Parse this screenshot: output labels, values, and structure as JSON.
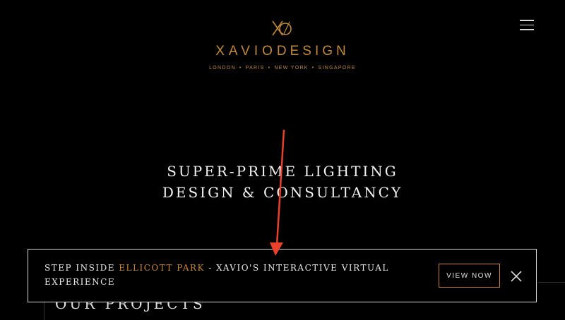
{
  "header": {
    "brand_part1": "XAVIO",
    "brand_part2": "DESIGN",
    "cities": [
      "LONDON",
      "PARIS",
      "NEW YORK",
      "SINGAPORE"
    ],
    "separator": "•",
    "logo_icon": "xo-monogram-icon",
    "menu_icon": "hamburger-menu-icon"
  },
  "hero": {
    "line1": "SUPER-PRIME LIGHTING",
    "line2": "DESIGN & CONSULTANCY"
  },
  "section": {
    "title": "OUR PROJECTS"
  },
  "banner": {
    "text_prefix": "STEP INSIDE ",
    "text_highlight": "ELLICOTT PARK",
    "text_suffix": " - XAVIO'S INTERACTIVE VIRTUAL EXPERIENCE",
    "cta_label": "VIEW NOW",
    "close_icon": "close-icon"
  },
  "colors": {
    "background": "#000000",
    "accent": "#c8893a",
    "annotation_arrow": "#e8412c"
  }
}
